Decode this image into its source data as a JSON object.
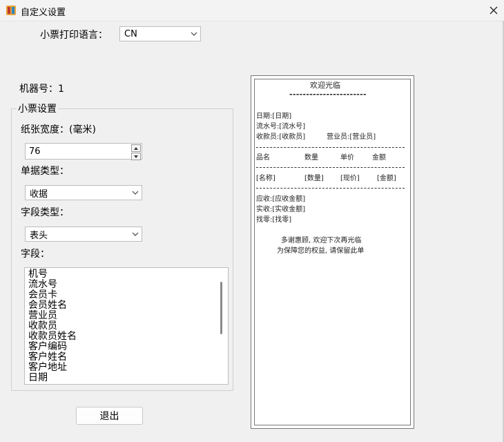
{
  "window": {
    "title": "自定义设置"
  },
  "receipt_language": {
    "label": "小票打印语言：",
    "value": "CN"
  },
  "machine": {
    "label": "机器号：1"
  },
  "group": {
    "title": "小票设置",
    "paper_width_label": "纸张宽度：(毫米)",
    "paper_width_value": "76",
    "doc_type_label": "单据类型：",
    "doc_type_value": "收据",
    "field_type_label": "字段类型：",
    "field_type_value": "表头",
    "fields_label": "字段：",
    "fields": [
      "机号",
      "流水号",
      "会员卡",
      "会员姓名",
      "营业员",
      "收款员",
      "收款员姓名",
      "客户编码",
      "客户姓名",
      "客户地址",
      "日期"
    ]
  },
  "buttons": {
    "exit": "退出"
  },
  "receipt": {
    "welcome": "欢迎光临",
    "header_rule": "-----------------------",
    "date": "日期:[日期]",
    "serial": "流水号:[流水号]",
    "cashier": "收款员:[收款员]",
    "salesperson": "营业员:[营业员]",
    "col_name": "品名",
    "col_qty": "数量",
    "col_price": "单价",
    "col_amount": "金额",
    "item_name": "[名称]",
    "item_qty": "[数量]",
    "item_price": "[现价]",
    "item_amount": "[金额]",
    "due": "应收:[应收金额]",
    "paid": "实收:[实收金额]",
    "change": "找零:[找零]",
    "thanks": "多谢惠顾, 欢迎下次再光临",
    "notice": "为保障您的权益, 请保留此单"
  }
}
